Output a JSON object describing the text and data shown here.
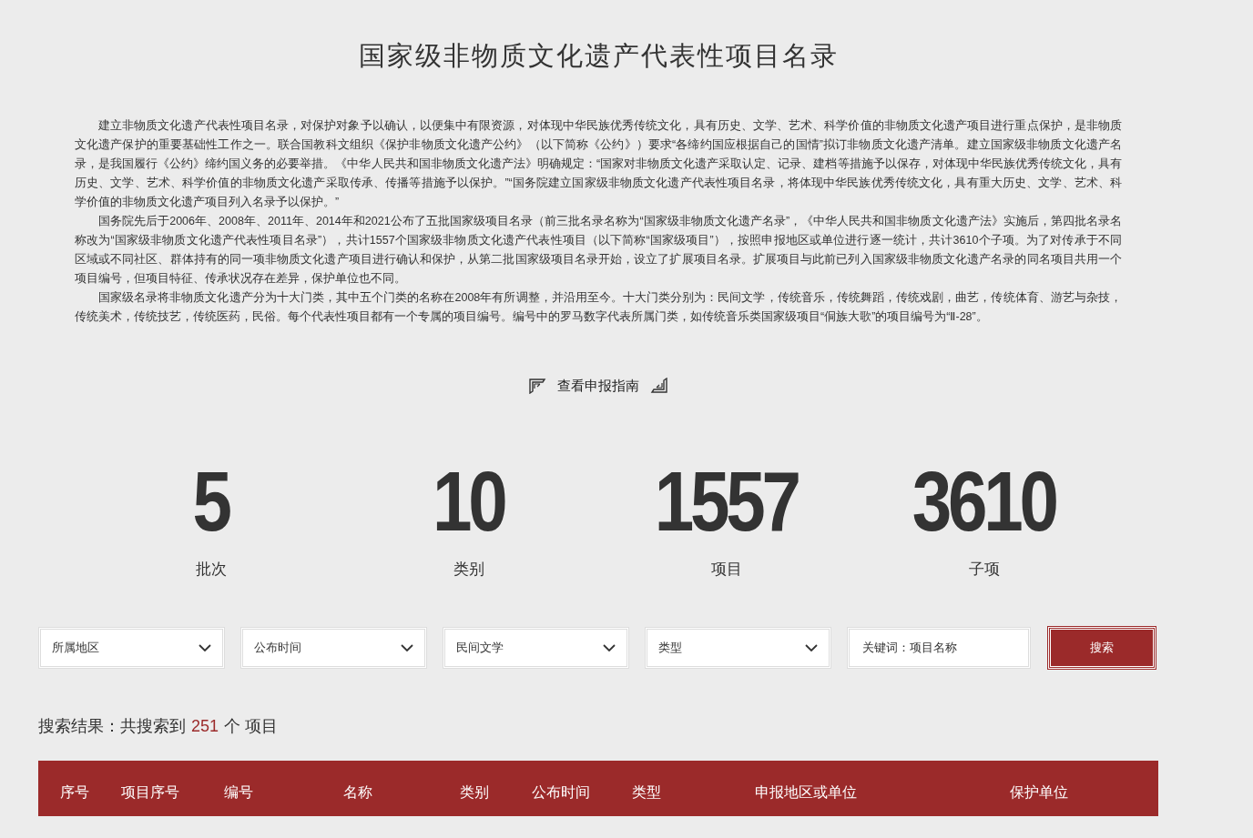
{
  "title": "国家级非物质文化遗产代表性项目名录",
  "intro": [
    "建立非物质文化遗产代表性项目名录，对保护对象予以确认，以便集中有限资源，对体现中华民族优秀传统文化，具有历史、文学、艺术、科学价值的非物质文化遗产项目进行重点保护，是非物质文化遗产保护的重要基础性工作之一。联合国教科文组织《保护非物质文化遗产公约》（以下简称《公约》）要求“各缔约国应根据自己的国情”拟订非物质文化遗产清单。建立国家级非物质文化遗产名录，是我国履行《公约》缔约国义务的必要举措。《中华人民共和国非物质文化遗产法》明确规定：“国家对非物质文化遗产采取认定、记录、建档等措施予以保存，对体现中华民族优秀传统文化，具有历史、文学、艺术、科学价值的非物质文化遗产采取传承、传播等措施予以保护。”“国务院建立国家级非物质文化遗产代表性项目名录，将体现中华民族优秀传统文化，具有重大历史、文学、艺术、科学价值的非物质文化遗产项目列入名录予以保护。”",
    "国务院先后于2006年、2008年、2011年、2014年和2021公布了五批国家级项目名录（前三批名录名称为“国家级非物质文化遗产名录”，《中华人民共和国非物质文化遗产法》实施后，第四批名录名称改为“国家级非物质文化遗产代表性项目名录”），共计1557个国家级非物质文化遗产代表性项目（以下简称“国家级项目”），按照申报地区或单位进行逐一统计，共计3610个子项。为了对传承于不同区域或不同社区、群体持有的同一项非物质文化遗产项目进行确认和保护，从第二批国家级项目名录开始，设立了扩展项目名录。扩展项目与此前已列入国家级非物质文化遗产名录的同名项目共用一个项目编号，但项目特征、传承状况存在差异，保护单位也不同。",
    "国家级名录将非物质文化遗产分为十大门类，其中五个门类的名称在2008年有所调整，并沿用至今。十大门类分别为：民间文学，传统音乐，传统舞蹈，传统戏剧，曲艺，传统体育、游艺与杂技，传统美术，传统技艺，传统医药，民俗。每个代表性项目都有一个专属的项目编号。编号中的罗马数字代表所属门类，如传统音乐类国家级项目“侗族大歌”的项目编号为“Ⅱ-28”。"
  ],
  "guide_link": "查看申报指南",
  "stats": [
    {
      "value": "5",
      "label": "批次"
    },
    {
      "value": "10",
      "label": "类别"
    },
    {
      "value": "1557",
      "label": "项目"
    },
    {
      "value": "3610",
      "label": "子项"
    }
  ],
  "filters": [
    {
      "kind": "select",
      "value": "所属地区"
    },
    {
      "kind": "select",
      "value": "公布时间"
    },
    {
      "kind": "select",
      "value": "民间文学"
    },
    {
      "kind": "select",
      "value": "类型"
    },
    {
      "kind": "input",
      "placeholder": "关键词：项目名称"
    }
  ],
  "search_button": "搜索",
  "result": {
    "prefix": "搜索结果：共搜索到",
    "count": "251",
    "suffix": "个 项目"
  },
  "table": {
    "columns": [
      "序号",
      "项目序号",
      "编号",
      "名称",
      "类别",
      "公布时间",
      "类型",
      "申报地区或单位",
      "保护单位"
    ]
  }
}
